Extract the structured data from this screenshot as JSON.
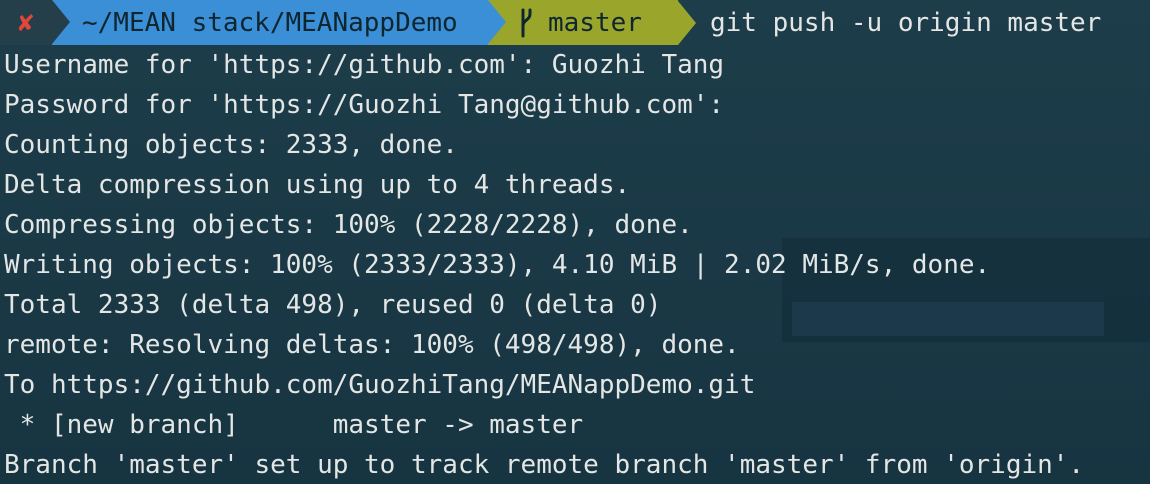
{
  "prompt": {
    "status_glyph": "✘",
    "directory": "~/MEAN stack/MEANappDemo",
    "branch": "master",
    "command": "git push -u origin master"
  },
  "output": [
    "Username for 'https://github.com': Guozhi Tang",
    "Password for 'https://Guozhi Tang@github.com':",
    "Counting objects: 2333, done.",
    "Delta compression using up to 4 threads.",
    "Compressing objects: 100% (2228/2228), done.",
    "Writing objects: 100% (2333/2333), 4.10 MiB | 2.02 MiB/s, done.",
    "Total 2333 (delta 498), reused 0 (delta 0)",
    "remote: Resolving deltas: 100% (498/498), done.",
    "To https://github.com/GuozhiTang/MEANappDemo.git",
    " * [new branch]      master -> master",
    "Branch 'master' set up to track remote branch 'master' from 'origin'."
  ],
  "colors": {
    "background": "#1b3a47",
    "text": "#e3e6e4",
    "status_error": "#e0473a",
    "segment_directory": "#3a8fd6",
    "segment_branch": "#9aa52b"
  },
  "icons": {
    "status": "cross-icon",
    "branch": "git-branch-icon"
  }
}
